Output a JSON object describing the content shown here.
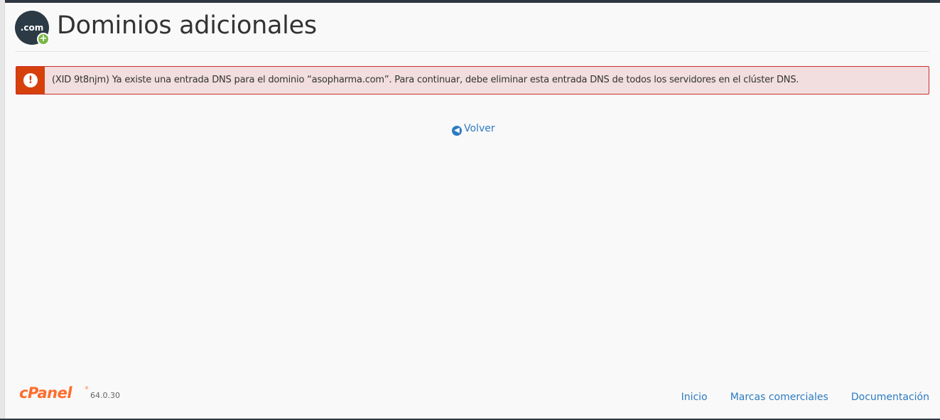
{
  "header": {
    "icon_label": ".com",
    "plus_symbol": "+",
    "title": "Dominios adicionales"
  },
  "alert": {
    "icon_symbol": "!",
    "message": "(XID 9t8njm) Ya existe una entrada DNS para el dominio “asopharma.com”. Para continuar, debe eliminar esta entrada DNS de todos los servidores en el clúster DNS."
  },
  "back": {
    "label": "Volver"
  },
  "footer": {
    "logo_text": "cPanel",
    "registered_mark": "®",
    "version": "64.0.30",
    "links": [
      "Inicio",
      "Marcas comerciales",
      "Documentación"
    ]
  },
  "colors": {
    "alert_bg": "#f2dede",
    "alert_border": "#c9302c",
    "alert_icon_bg": "#d6400a",
    "link": "#2c7bc1",
    "brand": "#ff6c2c",
    "plus_badge": "#7ab648"
  }
}
